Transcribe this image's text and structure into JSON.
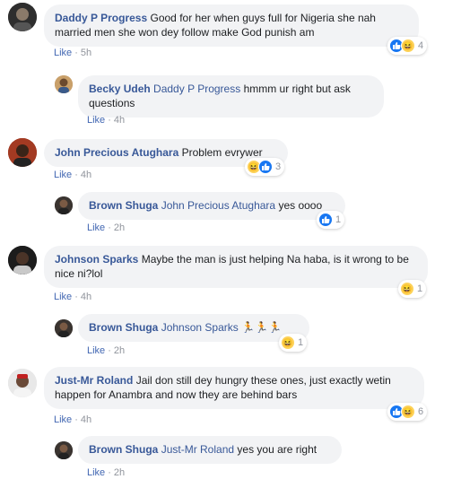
{
  "comments": [
    {
      "name": "Daddy P Progress",
      "text": "Good for her when guys full for Nigeria she nah married men she won dey follow make God punish am",
      "like": "Like",
      "time": "5h",
      "reaction_count": "4",
      "reactions": [
        "like-icon",
        "haha-icon"
      ]
    },
    {
      "name": "Becky Udeh",
      "tag": "Daddy P Progress",
      "text": "hmmm ur right but ask questions",
      "like": "Like",
      "time": "4h"
    },
    {
      "name": "John Precious Atughara",
      "text": "Problem evrywer",
      "like": "Like",
      "time": "4h",
      "reaction_count": "3",
      "reactions": [
        "haha-icon",
        "like-icon"
      ]
    },
    {
      "name": "Brown Shuga",
      "tag": "John Precious Atughara",
      "text": "yes oooo",
      "like": "Like",
      "time": "2h",
      "reaction_count": "1",
      "reactions": [
        "like-icon"
      ]
    },
    {
      "name": "Johnson Sparks",
      "text": "Maybe the man is just helping Na haba, is it wrong to be nice ni?lol",
      "like": "Like",
      "time": "4h",
      "reaction_count": "1",
      "reactions": [
        "haha-icon"
      ]
    },
    {
      "name": "Brown Shuga",
      "tag": "Johnson Sparks",
      "text": "🏃🏃🏃",
      "like": "Like",
      "time": "2h",
      "reaction_count": "1",
      "reactions": [
        "haha-icon"
      ]
    },
    {
      "name": "Just-Mr Roland",
      "text": "Jail don still dey hungry these ones, just exactly wetin happen for Anambra and now they are behind bars",
      "like": "Like",
      "time": "4h",
      "reaction_count": "6",
      "reactions": [
        "like-icon",
        "haha-icon"
      ]
    },
    {
      "name": "Brown Shuga",
      "tag": "Just-Mr Roland",
      "text": "yes you are right",
      "like": "Like",
      "time": "2h"
    }
  ],
  "dot": "·",
  "colors": {
    "link": "#385898",
    "bubble": "#f2f3f5",
    "meta": "#90949c",
    "like_blue": "#1877f2",
    "haha_yellow": "#fdd257"
  }
}
